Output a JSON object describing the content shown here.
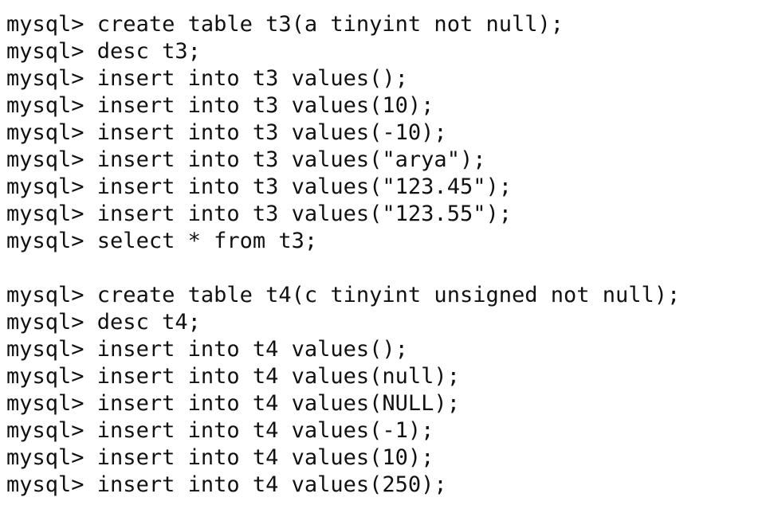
{
  "terminal": {
    "prompt": "mysql> ",
    "block1": [
      "create table t3(a tinyint not null);",
      "desc t3;",
      "insert into t3 values();",
      "insert into t3 values(10);",
      "insert into t3 values(-10);",
      "insert into t3 values(\"arya\");",
      "insert into t3 values(\"123.45\");",
      "insert into t3 values(\"123.55\");",
      "select * from t3;"
    ],
    "block2": [
      "create table t4(c tinyint unsigned not null);",
      "desc t4;",
      "insert into t4 values();",
      "insert into t4 values(null);",
      "insert into t4 values(NULL);",
      "insert into t4 values(-1);",
      "insert into t4 values(10);",
      "insert into t4 values(250);"
    ]
  }
}
